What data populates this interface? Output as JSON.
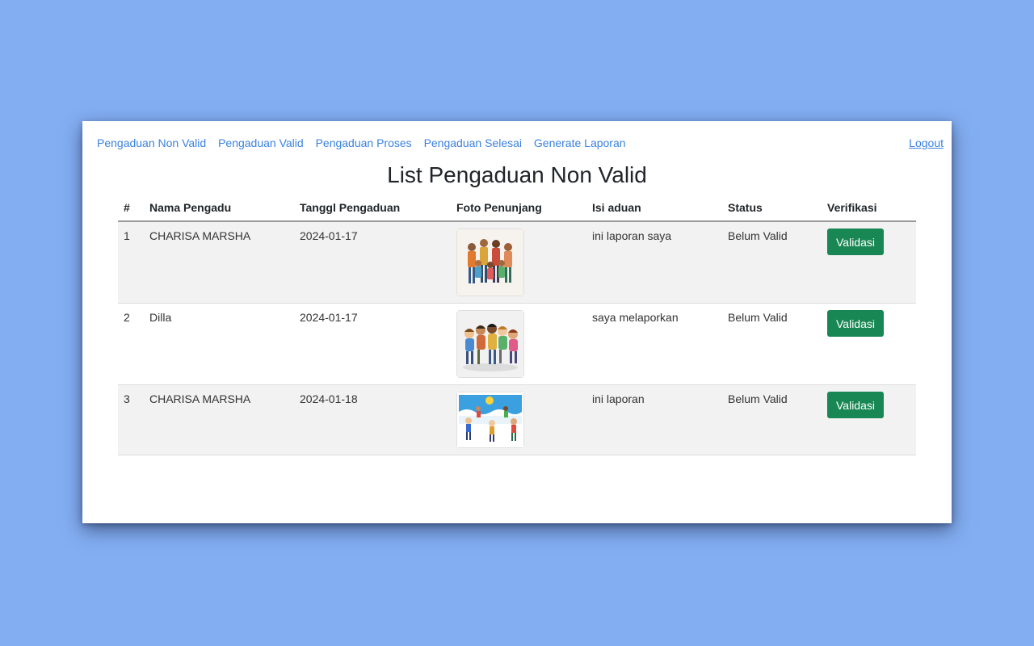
{
  "nav": {
    "links": [
      "Pengaduan Non Valid",
      "Pengaduan Valid",
      "Pengaduan Proses",
      "Pengaduan Selesai",
      "Generate Laporan"
    ],
    "logout": "Logout"
  },
  "page": {
    "title": "List Pengaduan Non Valid"
  },
  "table": {
    "headers": [
      "#",
      "Nama Pengadu",
      "Tanggl Pengaduan",
      "Foto Penunjang",
      "Isi aduan",
      "Status",
      "Verifikasi"
    ],
    "rows": [
      {
        "no": "1",
        "nama": "CHARISA MARSHA",
        "tanggal": "2024-01-17",
        "foto": "family-group-photo",
        "isi": "ini laporan saya",
        "status": "Belum Valid",
        "action": "Validasi"
      },
      {
        "no": "2",
        "nama": "Dilla",
        "tanggal": "2024-01-17",
        "foto": "kids-group-photo",
        "isi": "saya melaporkan",
        "status": "Belum Valid",
        "action": "Validasi"
      },
      {
        "no": "3",
        "nama": "CHARISA MARSHA",
        "tanggal": "2024-01-18",
        "foto": "kids-beach-photo",
        "isi": "ini laporan",
        "status": "Belum Valid",
        "action": "Validasi"
      }
    ]
  },
  "colors": {
    "background": "#83aef2",
    "link": "#3b82e0",
    "button": "#198754",
    "stripe": "#f2f2f2"
  }
}
